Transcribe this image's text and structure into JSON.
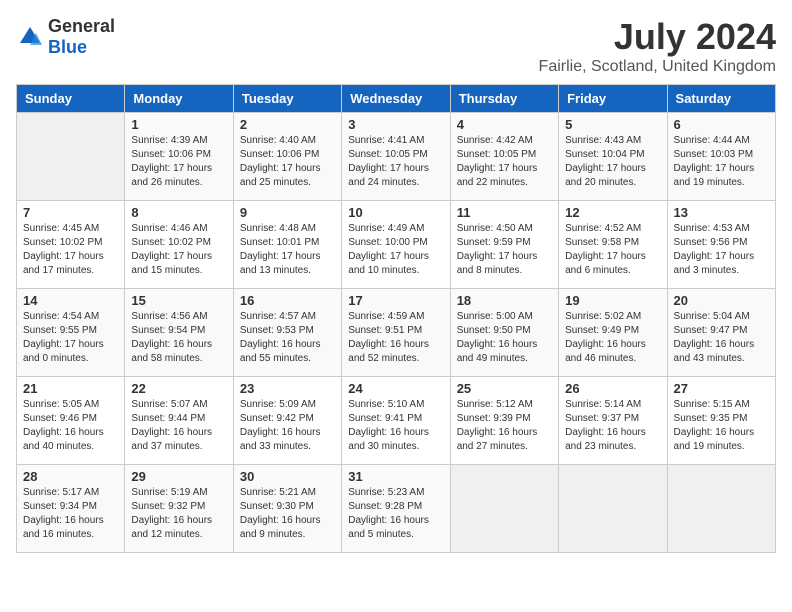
{
  "header": {
    "logo_general": "General",
    "logo_blue": "Blue",
    "month": "July 2024",
    "location": "Fairlie, Scotland, United Kingdom"
  },
  "days_of_week": [
    "Sunday",
    "Monday",
    "Tuesday",
    "Wednesday",
    "Thursday",
    "Friday",
    "Saturday"
  ],
  "weeks": [
    [
      {
        "day": "",
        "sunrise": "",
        "sunset": "",
        "daylight": ""
      },
      {
        "day": "1",
        "sunrise": "Sunrise: 4:39 AM",
        "sunset": "Sunset: 10:06 PM",
        "daylight": "Daylight: 17 hours and 26 minutes."
      },
      {
        "day": "2",
        "sunrise": "Sunrise: 4:40 AM",
        "sunset": "Sunset: 10:06 PM",
        "daylight": "Daylight: 17 hours and 25 minutes."
      },
      {
        "day": "3",
        "sunrise": "Sunrise: 4:41 AM",
        "sunset": "Sunset: 10:05 PM",
        "daylight": "Daylight: 17 hours and 24 minutes."
      },
      {
        "day": "4",
        "sunrise": "Sunrise: 4:42 AM",
        "sunset": "Sunset: 10:05 PM",
        "daylight": "Daylight: 17 hours and 22 minutes."
      },
      {
        "day": "5",
        "sunrise": "Sunrise: 4:43 AM",
        "sunset": "Sunset: 10:04 PM",
        "daylight": "Daylight: 17 hours and 20 minutes."
      },
      {
        "day": "6",
        "sunrise": "Sunrise: 4:44 AM",
        "sunset": "Sunset: 10:03 PM",
        "daylight": "Daylight: 17 hours and 19 minutes."
      }
    ],
    [
      {
        "day": "7",
        "sunrise": "Sunrise: 4:45 AM",
        "sunset": "Sunset: 10:02 PM",
        "daylight": "Daylight: 17 hours and 17 minutes."
      },
      {
        "day": "8",
        "sunrise": "Sunrise: 4:46 AM",
        "sunset": "Sunset: 10:02 PM",
        "daylight": "Daylight: 17 hours and 15 minutes."
      },
      {
        "day": "9",
        "sunrise": "Sunrise: 4:48 AM",
        "sunset": "Sunset: 10:01 PM",
        "daylight": "Daylight: 17 hours and 13 minutes."
      },
      {
        "day": "10",
        "sunrise": "Sunrise: 4:49 AM",
        "sunset": "Sunset: 10:00 PM",
        "daylight": "Daylight: 17 hours and 10 minutes."
      },
      {
        "day": "11",
        "sunrise": "Sunrise: 4:50 AM",
        "sunset": "Sunset: 9:59 PM",
        "daylight": "Daylight: 17 hours and 8 minutes."
      },
      {
        "day": "12",
        "sunrise": "Sunrise: 4:52 AM",
        "sunset": "Sunset: 9:58 PM",
        "daylight": "Daylight: 17 hours and 6 minutes."
      },
      {
        "day": "13",
        "sunrise": "Sunrise: 4:53 AM",
        "sunset": "Sunset: 9:56 PM",
        "daylight": "Daylight: 17 hours and 3 minutes."
      }
    ],
    [
      {
        "day": "14",
        "sunrise": "Sunrise: 4:54 AM",
        "sunset": "Sunset: 9:55 PM",
        "daylight": "Daylight: 17 hours and 0 minutes."
      },
      {
        "day": "15",
        "sunrise": "Sunrise: 4:56 AM",
        "sunset": "Sunset: 9:54 PM",
        "daylight": "Daylight: 16 hours and 58 minutes."
      },
      {
        "day": "16",
        "sunrise": "Sunrise: 4:57 AM",
        "sunset": "Sunset: 9:53 PM",
        "daylight": "Daylight: 16 hours and 55 minutes."
      },
      {
        "day": "17",
        "sunrise": "Sunrise: 4:59 AM",
        "sunset": "Sunset: 9:51 PM",
        "daylight": "Daylight: 16 hours and 52 minutes."
      },
      {
        "day": "18",
        "sunrise": "Sunrise: 5:00 AM",
        "sunset": "Sunset: 9:50 PM",
        "daylight": "Daylight: 16 hours and 49 minutes."
      },
      {
        "day": "19",
        "sunrise": "Sunrise: 5:02 AM",
        "sunset": "Sunset: 9:49 PM",
        "daylight": "Daylight: 16 hours and 46 minutes."
      },
      {
        "day": "20",
        "sunrise": "Sunrise: 5:04 AM",
        "sunset": "Sunset: 9:47 PM",
        "daylight": "Daylight: 16 hours and 43 minutes."
      }
    ],
    [
      {
        "day": "21",
        "sunrise": "Sunrise: 5:05 AM",
        "sunset": "Sunset: 9:46 PM",
        "daylight": "Daylight: 16 hours and 40 minutes."
      },
      {
        "day": "22",
        "sunrise": "Sunrise: 5:07 AM",
        "sunset": "Sunset: 9:44 PM",
        "daylight": "Daylight: 16 hours and 37 minutes."
      },
      {
        "day": "23",
        "sunrise": "Sunrise: 5:09 AM",
        "sunset": "Sunset: 9:42 PM",
        "daylight": "Daylight: 16 hours and 33 minutes."
      },
      {
        "day": "24",
        "sunrise": "Sunrise: 5:10 AM",
        "sunset": "Sunset: 9:41 PM",
        "daylight": "Daylight: 16 hours and 30 minutes."
      },
      {
        "day": "25",
        "sunrise": "Sunrise: 5:12 AM",
        "sunset": "Sunset: 9:39 PM",
        "daylight": "Daylight: 16 hours and 27 minutes."
      },
      {
        "day": "26",
        "sunrise": "Sunrise: 5:14 AM",
        "sunset": "Sunset: 9:37 PM",
        "daylight": "Daylight: 16 hours and 23 minutes."
      },
      {
        "day": "27",
        "sunrise": "Sunrise: 5:15 AM",
        "sunset": "Sunset: 9:35 PM",
        "daylight": "Daylight: 16 hours and 19 minutes."
      }
    ],
    [
      {
        "day": "28",
        "sunrise": "Sunrise: 5:17 AM",
        "sunset": "Sunset: 9:34 PM",
        "daylight": "Daylight: 16 hours and 16 minutes."
      },
      {
        "day": "29",
        "sunrise": "Sunrise: 5:19 AM",
        "sunset": "Sunset: 9:32 PM",
        "daylight": "Daylight: 16 hours and 12 minutes."
      },
      {
        "day": "30",
        "sunrise": "Sunrise: 5:21 AM",
        "sunset": "Sunset: 9:30 PM",
        "daylight": "Daylight: 16 hours and 9 minutes."
      },
      {
        "day": "31",
        "sunrise": "Sunrise: 5:23 AM",
        "sunset": "Sunset: 9:28 PM",
        "daylight": "Daylight: 16 hours and 5 minutes."
      },
      {
        "day": "",
        "sunrise": "",
        "sunset": "",
        "daylight": ""
      },
      {
        "day": "",
        "sunrise": "",
        "sunset": "",
        "daylight": ""
      },
      {
        "day": "",
        "sunrise": "",
        "sunset": "",
        "daylight": ""
      }
    ]
  ]
}
